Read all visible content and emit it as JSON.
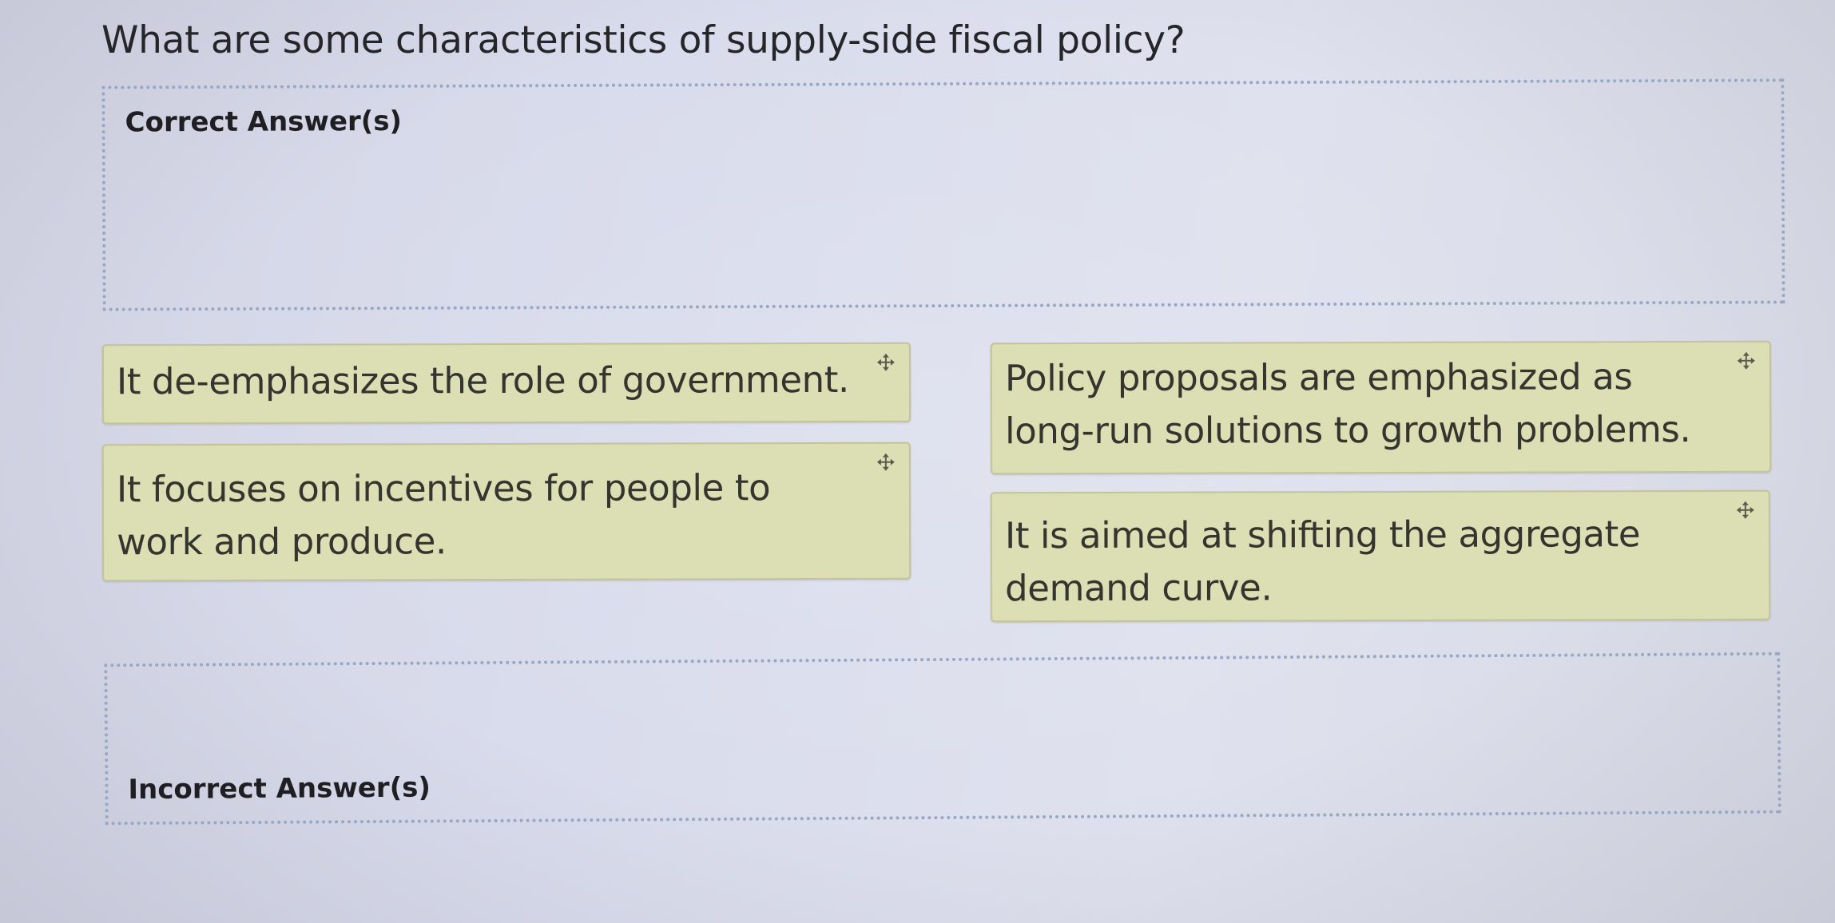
{
  "question": {
    "text": "What are some characteristics of supply-side fiscal policy?"
  },
  "zones": {
    "correct_label": "Correct Answer(s)",
    "incorrect_label": "Incorrect Answer(s)"
  },
  "cards": [
    {
      "text": "It de-emphasizes the role of government.",
      "icon": "move-icon"
    },
    {
      "text": "It focuses on incentives for people to work and produce.",
      "icon": "move-icon"
    },
    {
      "text": "Policy proposals are emphasized as long-run solutions to growth problems.",
      "icon": "move-icon"
    },
    {
      "text": "It is aimed at shifting the aggregate demand curve.",
      "icon": "move-icon"
    }
  ],
  "colors": {
    "card_background": "#dcdeb3",
    "zone_border": "#98a8c4",
    "page_background": "#d9dcec"
  }
}
